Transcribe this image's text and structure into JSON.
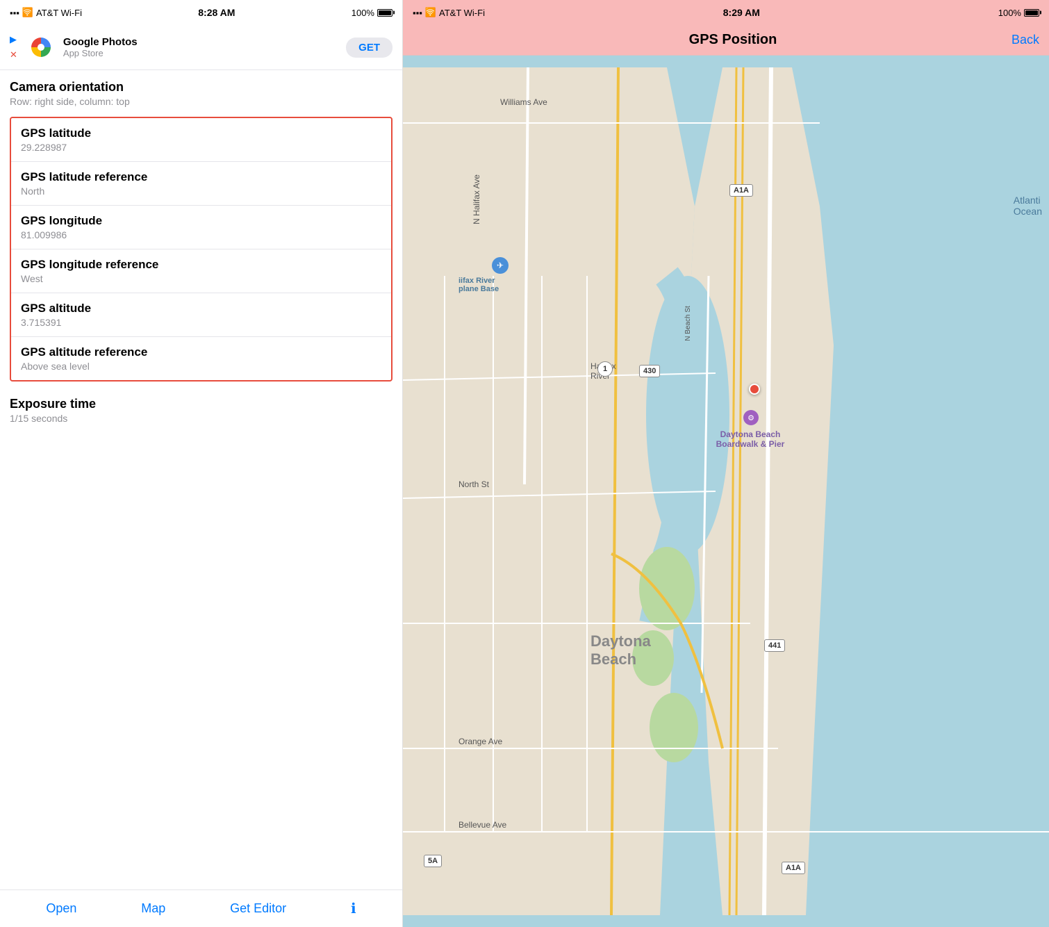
{
  "left": {
    "status_bar": {
      "carrier": "AT&T Wi-Fi",
      "time": "8:28 AM",
      "battery": "100%"
    },
    "app_banner": {
      "app_name": "Google Photos",
      "store_label": "App Store",
      "get_button": "GET"
    },
    "section": {
      "title": "Camera orientation",
      "subtitle": "Row: right side, column: top"
    },
    "gps_items": [
      {
        "label": "GPS latitude",
        "value": "29.228987"
      },
      {
        "label": "GPS latitude reference",
        "value": "North"
      },
      {
        "label": "GPS longitude",
        "value": "81.009986"
      },
      {
        "label": "GPS longitude reference",
        "value": "West"
      },
      {
        "label": "GPS altitude",
        "value": "3.715391"
      },
      {
        "label": "GPS altitude reference",
        "value": "Above sea level"
      }
    ],
    "exposure": {
      "label": "Exposure time",
      "value": "1/15 seconds"
    },
    "toolbar": {
      "open": "Open",
      "map": "Map",
      "get_editor": "Get Editor",
      "info": "ℹ"
    }
  },
  "right": {
    "status_bar": {
      "carrier": "AT&T Wi-Fi",
      "time": "8:29 AM",
      "battery": "100%"
    },
    "nav": {
      "title": "GPS Position",
      "back": "Back"
    },
    "map": {
      "location_name": "Daytona Beach",
      "poi": "Daytona Beach Boardwalk & Pier",
      "airport": "iifax River plane Base",
      "streets": [
        "Williams Ave",
        "N Halifax Ave",
        "Halifax River",
        "N Beach St",
        "North St",
        "Orange Ave",
        "Bellevue Ave"
      ],
      "roads": [
        "A1A",
        "1",
        "430",
        "441",
        "5A",
        "A1A"
      ]
    }
  }
}
